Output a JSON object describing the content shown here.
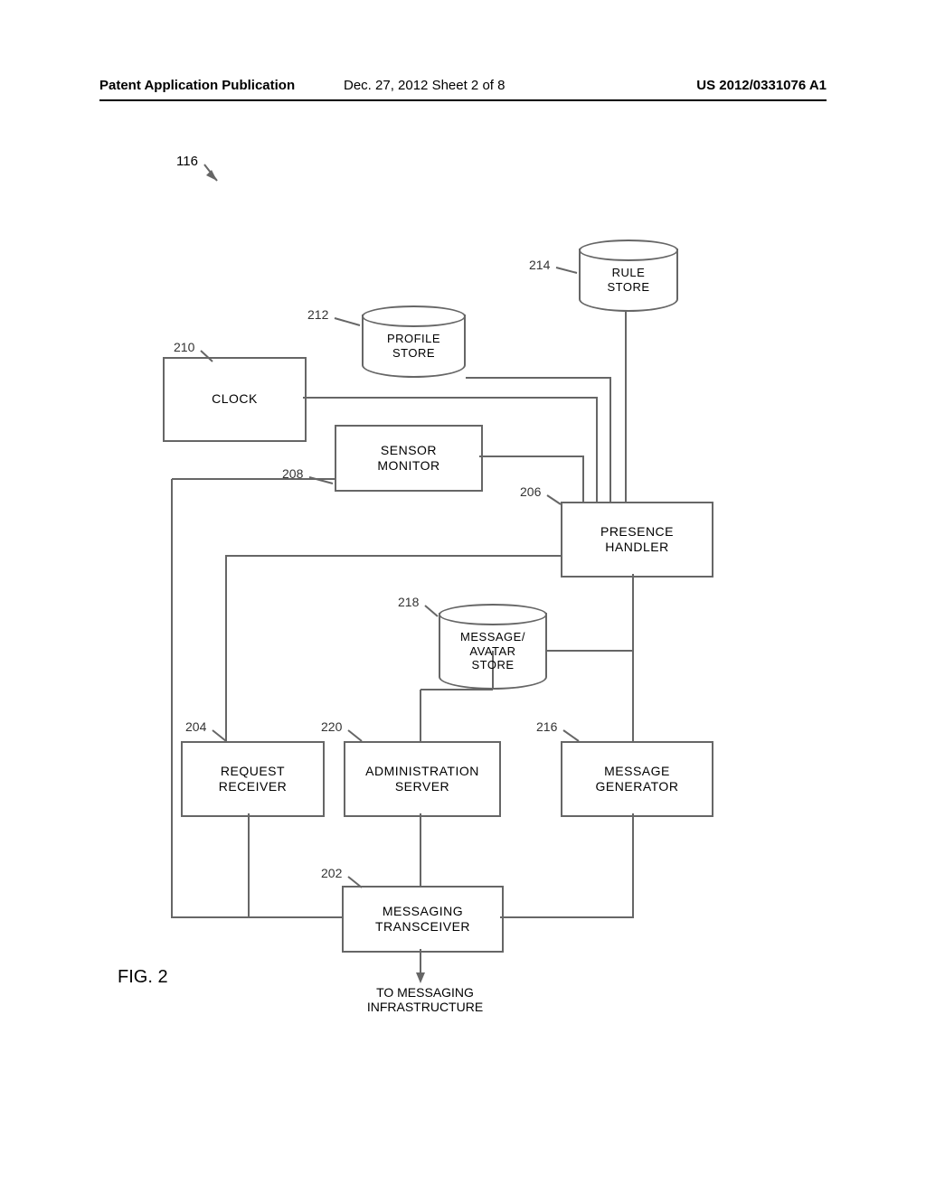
{
  "header": {
    "left": "Patent Application Publication",
    "mid": "Dec. 27, 2012  Sheet 2 of 8",
    "right": "US 2012/0331076 A1"
  },
  "overall_ref": "116",
  "blocks": {
    "clock": {
      "ref": "210",
      "label": "CLOCK"
    },
    "profile": {
      "ref": "212",
      "label": "PROFILE\nSTORE"
    },
    "rule": {
      "ref": "214",
      "label": "RULE\nSTORE"
    },
    "sensor": {
      "ref": "208",
      "label": "SENSOR\nMONITOR"
    },
    "presence": {
      "ref": "206",
      "label": "PRESENCE\nHANDLER"
    },
    "msgstore": {
      "ref": "218",
      "label": "MESSAGE/\nAVATAR\nSTORE"
    },
    "request": {
      "ref": "204",
      "label": "REQUEST\nRECEIVER"
    },
    "admin": {
      "ref": "220",
      "label": "ADMINISTRATION\nSERVER"
    },
    "msggen": {
      "ref": "216",
      "label": "MESSAGE\nGENERATOR"
    },
    "transceiver": {
      "ref": "202",
      "label": "MESSAGING\nTRANSCEIVER"
    }
  },
  "footer": "TO MESSAGING\nINFRASTRUCTURE",
  "figure_label": "FIG. 2"
}
